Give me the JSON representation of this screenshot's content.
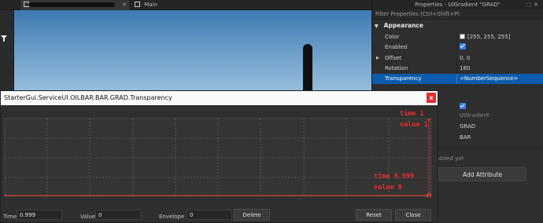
{
  "tabs": [
    {
      "label": ""
    },
    {
      "label": "Main"
    }
  ],
  "viewport": {
    "sky_top": "#3f79b2",
    "sky_bottom": "#9ec3df"
  },
  "properties": {
    "title": "Properties - UIGradient \"GRAD\"",
    "filter_placeholder": "Filter Properties (Ctrl+Shift+P)",
    "section": "Appearance",
    "rows": [
      {
        "name": "Color",
        "value": "[255, 255, 255]"
      },
      {
        "name": "Enabled",
        "value": ""
      },
      {
        "name": "Offset",
        "value": "0, 0"
      },
      {
        "name": "Rotation",
        "value": "180"
      },
      {
        "name": "Transparency",
        "value": "<NumberSequence>"
      }
    ],
    "lower_values": [
      "UIGradient",
      "GRAD",
      "BAR"
    ],
    "attributes_empty": "added yet",
    "add_attribute": "Add Attribute"
  },
  "dialog": {
    "title": "StarterGui.ServiceUI.OILBAR.BAR.GRAD.Transparency",
    "close": "x",
    "annotations": {
      "top_time": "time 1",
      "top_value": "value 1",
      "bottom_time": "time 0.999",
      "bottom_value": "value 0"
    },
    "footer": {
      "time_label": "Time",
      "time_value": "0.999",
      "value_label": "Value",
      "value_value": "0",
      "envelope_label": "Envelope",
      "envelope_value": "0",
      "delete": "Delete",
      "reset": "Reset",
      "close": "Close"
    }
  },
  "colors": {
    "selection": "#0b5cad",
    "annotation": "#ea2d2d",
    "checkbox": "#2f80ed"
  }
}
